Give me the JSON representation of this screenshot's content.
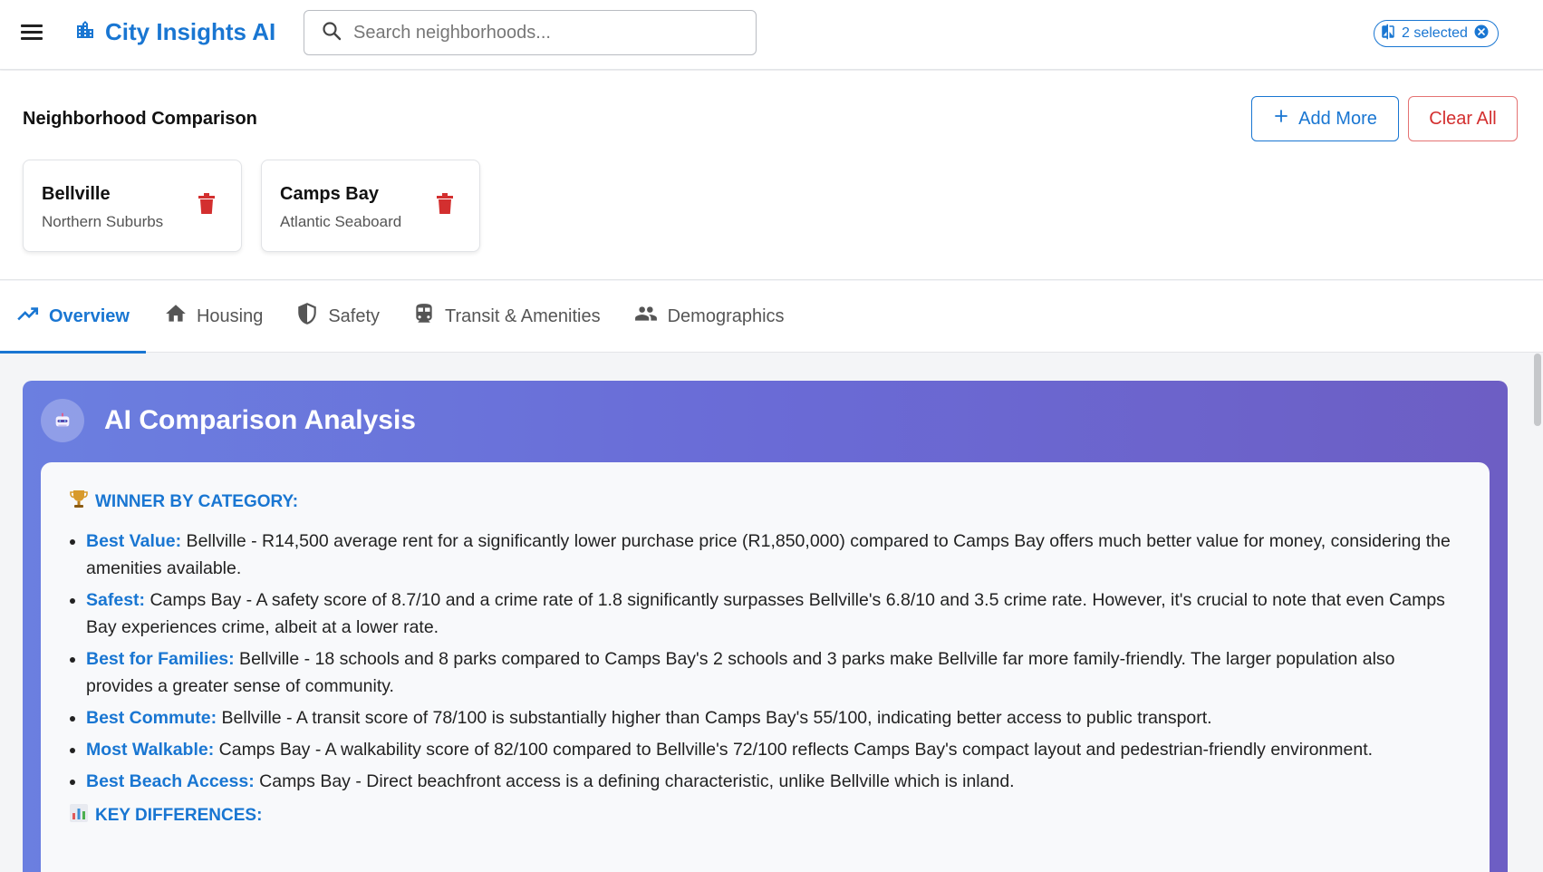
{
  "app": {
    "title": "City Insights AI",
    "search_placeholder": "Search neighborhoods...",
    "selected_chip": "2 selected"
  },
  "comparison": {
    "title": "Neighborhood Comparison",
    "add_more": "Add More",
    "clear_all": "Clear All",
    "neighborhoods": [
      {
        "name": "Bellville",
        "area": "Northern Suburbs"
      },
      {
        "name": "Camps Bay",
        "area": "Atlantic Seaboard"
      }
    ]
  },
  "tabs": [
    {
      "label": "Overview",
      "icon": "trending-up-icon",
      "active": true
    },
    {
      "label": "Housing",
      "icon": "home-icon"
    },
    {
      "label": "Safety",
      "icon": "shield-icon"
    },
    {
      "label": "Transit & Amenities",
      "icon": "train-icon"
    },
    {
      "label": "Demographics",
      "icon": "people-icon"
    }
  ],
  "ai": {
    "title": "AI Comparison Analysis",
    "winner_heading": "WINNER BY CATEGORY:",
    "items": [
      {
        "label": "Best Value:",
        "text": " Bellville - R14,500 average rent for a significantly lower purchase price (R1,850,000) compared to Camps Bay offers much better value for money, considering the amenities available."
      },
      {
        "label": "Safest:",
        "text": " Camps Bay - A safety score of 8.7/10 and a crime rate of 1.8 significantly surpasses Bellville's 6.8/10 and 3.5 crime rate. However, it's crucial to note that even Camps Bay experiences crime, albeit at a lower rate."
      },
      {
        "label": "Best for Families:",
        "text": " Bellville - 18 schools and 8 parks compared to Camps Bay's 2 schools and 3 parks make Bellville far more family-friendly. The larger population also provides a greater sense of community."
      },
      {
        "label": "Best Commute:",
        "text": " Bellville - A transit score of 78/100 is substantially higher than Camps Bay's 55/100, indicating better access to public transport."
      },
      {
        "label": "Most Walkable:",
        "text": " Camps Bay - A walkability score of 82/100 compared to Bellville's 72/100 reflects Camps Bay's compact layout and pedestrian-friendly environment."
      },
      {
        "label": "Best Beach Access:",
        "text": " Camps Bay - Direct beachfront access is a defining characteristic, unlike Bellville which is inland."
      }
    ],
    "differences_heading": "KEY DIFFERENCES:"
  },
  "colors": {
    "primary": "#1976d2",
    "danger": "#d32f2f",
    "gradient_start": "#6b7fe0",
    "gradient_end": "#6d5ec4"
  }
}
